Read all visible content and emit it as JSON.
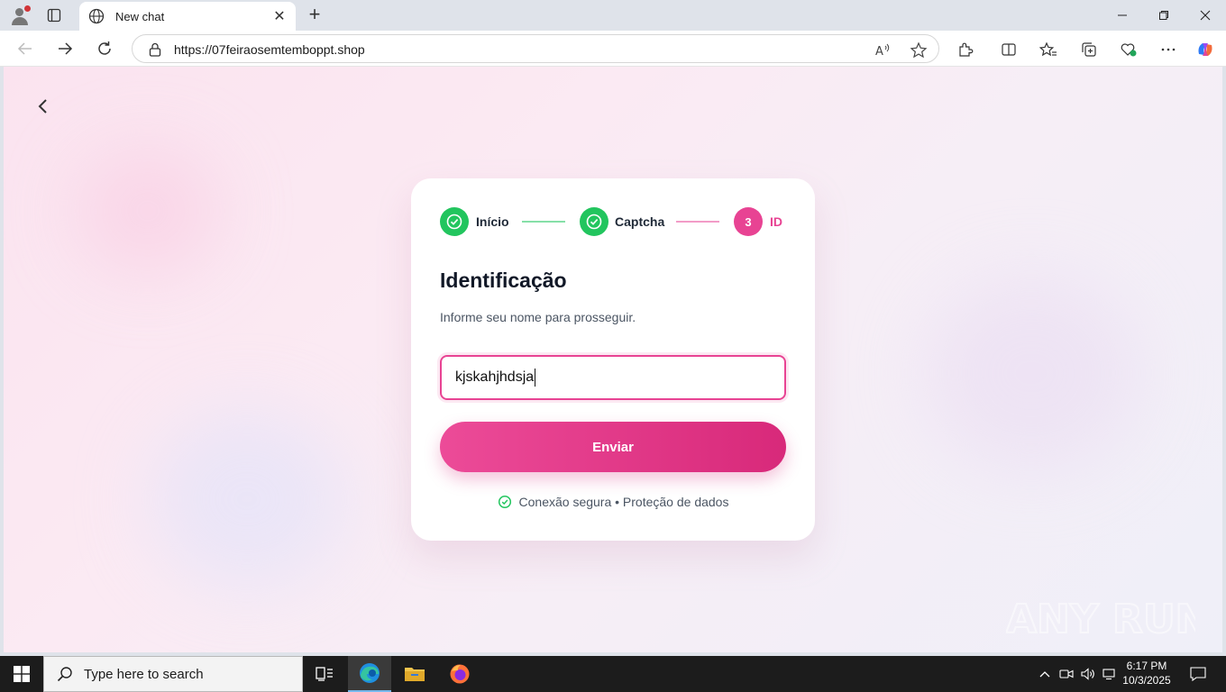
{
  "browser": {
    "tab_title": "New chat",
    "url": "https://07feiraosemtemboppt.shop",
    "new_tab_symbol": "+",
    "close_tab_symbol": "✕"
  },
  "page": {
    "steps": [
      {
        "label": "Início",
        "state": "done"
      },
      {
        "label": "Captcha",
        "state": "done"
      },
      {
        "number": "3",
        "label": "ID",
        "state": "active"
      }
    ],
    "heading": "Identificação",
    "subtitle": "Informe seu nome para prosseguir.",
    "name_input_value": "kjskahjhdsja",
    "submit_label": "Enviar",
    "secure_text": "Conexão segura • Proteção de dados",
    "colors": {
      "accent": "#e84393",
      "success": "#22c55e"
    }
  },
  "watermark": "ANY RUN",
  "taskbar": {
    "search_placeholder": "Type here to search",
    "time": "6:17 PM",
    "date": "10/3/2025"
  }
}
